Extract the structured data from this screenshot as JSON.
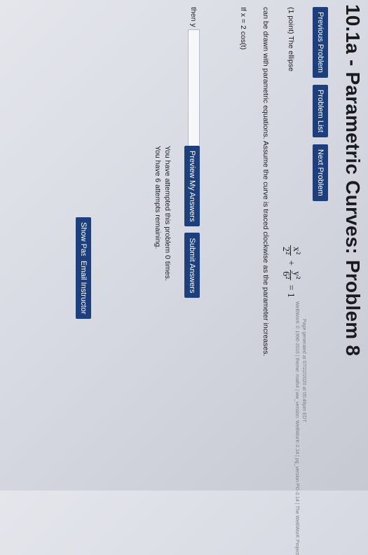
{
  "page": {
    "title": "10.1a - Parametric Curves: Problem 8"
  },
  "nav": {
    "previous": "Previous Problem",
    "list": "Problem List",
    "next": "Next Problem"
  },
  "problem": {
    "intro": "(1 point) The ellipse",
    "equation": {
      "term1_num": "x²",
      "term1_den": "2²",
      "plus": "+",
      "term2_num": "y²",
      "term2_den": "6²",
      "rhs": "= 1"
    },
    "statement": "can be drawn with parametric equations. Assume the curve is traced clockwise as the parameter increases.",
    "given": "If x = 2 cos(t)",
    "prompt": "then y =",
    "answer_value": ""
  },
  "actions": {
    "preview": "Preview My Answers",
    "submit": "Submit Answers"
  },
  "status": {
    "attempted": "You have attempted this problem 0 times.",
    "remaining": "You have 6 attempts remaining."
  },
  "sidebar": {
    "show_past": "Show Past Answers",
    "email": "Email Instructor"
  },
  "footer": {
    "generated": "Page generated at 07/22/2020 at 05:48pm EDT",
    "copyright": "WeBWorK © 1996-2016 | theme: math4 | ww_version: WeBWorK-2.14 | pg_version PG-2.14 | The WeBWorK Project"
  },
  "icons": {
    "answer_helper": "grid-icon"
  },
  "colors": {
    "button": "#1d3f7d",
    "page_bg": "#dcdfe6"
  }
}
